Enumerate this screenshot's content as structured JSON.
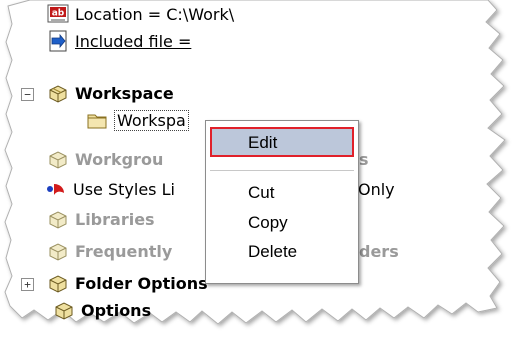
{
  "tree": {
    "rows": [
      {
        "label": "Location = C:\\Work\\",
        "icon": "ab-text-icon"
      },
      {
        "label": "Included file =",
        "icon": "include-arrow-icon"
      },
      {
        "label": "Workspace",
        "icon": "package-icon"
      },
      {
        "label": "Workspa",
        "icon": "folder-icon"
      },
      {
        "label": "Workgrou",
        "label_tail": "s",
        "icon": "package-icon"
      },
      {
        "label": "Use Styles Li",
        "label_tail": "Only",
        "icon": "styles-icon"
      },
      {
        "label": "Libraries",
        "icon": "package-icon"
      },
      {
        "label": "Frequently",
        "label_tail": "ders",
        "icon": "package-icon"
      },
      {
        "label": "Folder Options",
        "icon": "package-icon"
      },
      {
        "label": "Options",
        "icon": "package-icon"
      }
    ],
    "expander_minus": "−",
    "expander_plus": "+"
  },
  "context_menu": {
    "items": [
      "Edit",
      "Cut",
      "Copy",
      "Delete"
    ],
    "highlight_color": "#e0202a"
  }
}
